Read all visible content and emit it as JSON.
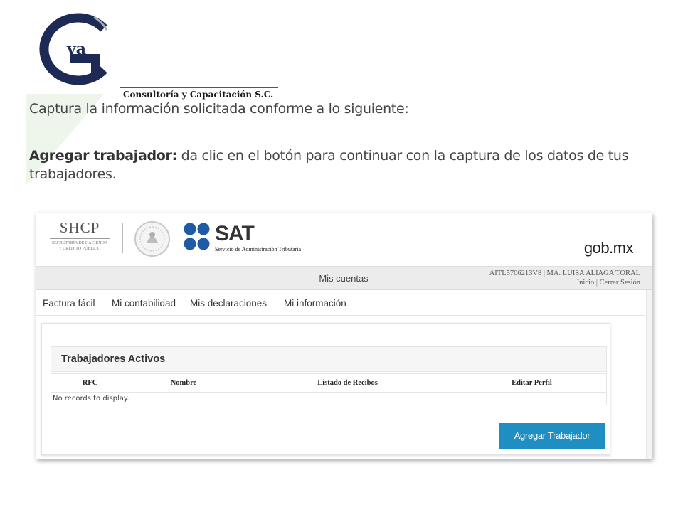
{
  "logo": {
    "letters": "va",
    "tagline": "Consultoría y Capacitación S.C."
  },
  "slide": {
    "line1": "Captura la información solicitada conforme a lo siguiente:",
    "bold": "Agregar trabajador:",
    "rest": " da clic en el botón para continuar con la captura de los datos de tus trabajadores."
  },
  "portal": {
    "shcp": {
      "title": "SHCP",
      "sub1": "SECRETARÍA DE HACIENDA",
      "sub2": "Y CRÉDITO PÚBLICO"
    },
    "sat": {
      "title": "SAT",
      "subtitle": "Servicio de Administración Tributaria"
    },
    "gobmx": "gob.mx",
    "account": {
      "center": "Mis cuentas",
      "user": "AITL5706213V8 | MA. LUISA ALIAGA TORAL",
      "inicio": "Inicio",
      "cerrar": "Cerrar Sesión"
    },
    "nav": [
      "Factura fácil",
      "Mi contabilidad",
      "Mis declaraciones",
      "Mi información"
    ],
    "panel": {
      "title": "Trabajadores Activos",
      "columns": [
        "RFC",
        "Nombre",
        "Listado de Recibos",
        "Editar Perfil"
      ],
      "empty": "No records to display.",
      "button": "Agregar Trabajador"
    }
  },
  "colors": {
    "button": "#1f8fc3",
    "logo_navy": "#1c2a55",
    "sat_blue": "#1f5aa6",
    "wedge": "#eef6ec"
  },
  "icons": [
    "gva-logo-icon",
    "mexican-seal-icon",
    "sat-dots-icon"
  ]
}
